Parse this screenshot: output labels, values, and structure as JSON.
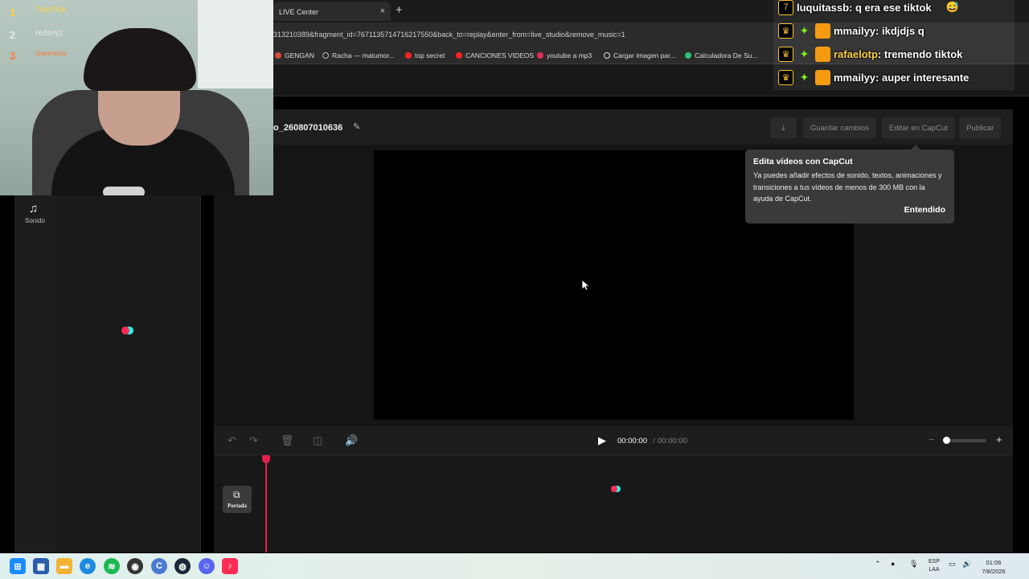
{
  "browser": {
    "tab_title": "LIVE Center",
    "tab_close": "×",
    "new_tab": "+",
    "url": "313210389&fragment_id=7671135714716217550&back_to=replay&enter_from=live_studio&remove_music=1",
    "bookmarks": [
      {
        "label": "GENGAN",
        "color": "#d94a3a"
      },
      {
        "label": "Racha — matumor...",
        "color": "#bbbbbb"
      },
      {
        "label": "top secret",
        "color": "#ff2020"
      },
      {
        "label": "CANCIONES VIDEOS",
        "color": "#ff2020"
      },
      {
        "label": "youtube a mp3",
        "color": "#e0305a"
      },
      {
        "label": "Cargar imagen par...",
        "color": "#dddddd"
      },
      {
        "label": "Calculadora De Su...",
        "color": "#2ec27e"
      }
    ]
  },
  "editor": {
    "project_title": "o_260807010636",
    "buttons": {
      "save": "Guardar cambios",
      "edit_capcut": "Editar en CapCut",
      "publish": "Publicar"
    },
    "sidebar": {
      "sound_label": "Sonido"
    },
    "tooltip": {
      "title": "Edita vídeos con CapCut",
      "body": "Ya puedes añadir efectos de sonido, textos, animaciones y transiciones a tus vídeos de menos de 300 MB con la ayuda de CapCut.",
      "button": "Entendido"
    },
    "player": {
      "current_time": "00:00:00",
      "separator": "/",
      "total_time": "00:00:00"
    },
    "cover_label": "Portada"
  },
  "stream_overlay": {
    "leaderboard": [
      {
        "rank": "1",
        "name": "TetePink",
        "color": "#f3d34a"
      },
      {
        "rank": "2",
        "name": "redseyz",
        "color": "#e8e8e8"
      },
      {
        "rank": "3",
        "name": "Queenkutz",
        "color": "#ff7a3a"
      }
    ],
    "chat": [
      {
        "user": "luquitassb",
        "message": "q era ese tiktok",
        "emoji": "😅"
      },
      {
        "user": "mmailyy",
        "message": "ikdjdjs q"
      },
      {
        "user": "rafaelotp",
        "message": "tremendo tiktok"
      },
      {
        "user": "mmailyy",
        "message": "auper interesante"
      }
    ]
  },
  "taskbar": {
    "language": "ESP",
    "language_sub": "LAA",
    "time": "01:06",
    "date": "7/8/2026"
  },
  "colors": {
    "accent": "#e4204f",
    "tiktok_cyan": "#25f4ee",
    "tiktok_red": "#fe2c55"
  }
}
